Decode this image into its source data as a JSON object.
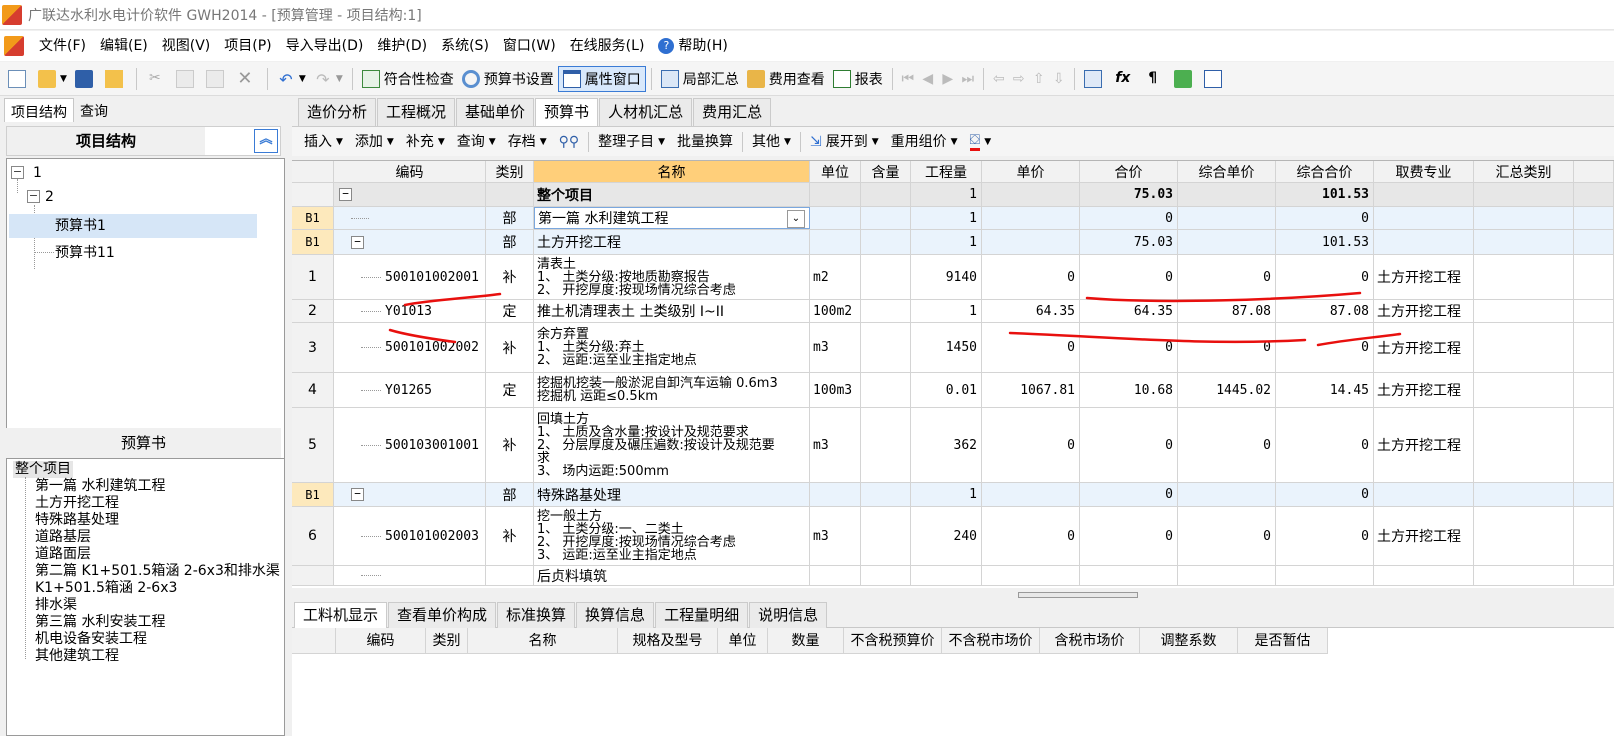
{
  "window": {
    "title": "广联达水利水电计价软件 GWH2014 - [预算管理 - 项目结构:1]"
  },
  "menu": [
    "文件(F)",
    "编辑(E)",
    "视图(V)",
    "项目(P)",
    "导入导出(D)",
    "维护(D)",
    "系统(S)",
    "窗口(W)",
    "在线服务(L)",
    "帮助(H)"
  ],
  "toolbar": {
    "compliance": "符合性检查",
    "budget_settings": "预算书设置",
    "property_window": "属性窗口",
    "partial_summary": "局部汇总",
    "fee_view": "费用查看",
    "report": "报表"
  },
  "left": {
    "tabs": [
      "项目结构",
      "查询"
    ],
    "structure_title": "项目结构",
    "tree": [
      {
        "label": "1",
        "toggle": "−"
      },
      {
        "label": "2",
        "toggle": "−"
      },
      {
        "label": "预算书1"
      },
      {
        "label": "预算书11"
      }
    ],
    "book_title": "预算书",
    "book_items": [
      "整个项目",
      "第一篇 水利建筑工程",
      "土方开挖工程",
      "特殊路基处理",
      "道路基层",
      "道路面层",
      "第二篇 K1+501.5箱涵 2-6x3和排水渠",
      "K1+501.5箱涵 2-6x3",
      "排水渠",
      "第三篇 水利安装工程",
      "机电设备安装工程",
      "其他建筑工程"
    ]
  },
  "tabs": [
    "造价分析",
    "工程概况",
    "基础单价",
    "预算书",
    "人材机汇总",
    "费用汇总"
  ],
  "subtoolbar": [
    {
      "label": "插入",
      "dd": true
    },
    {
      "label": "添加",
      "dd": true
    },
    {
      "label": "补充",
      "dd": true
    },
    {
      "label": "查询",
      "dd": true
    },
    {
      "label": "存档",
      "dd": true
    },
    {
      "label": "整理子目",
      "dd": true
    },
    {
      "label": "批量换算",
      "dd": false
    },
    {
      "label": "其他",
      "dd": true
    },
    {
      "label": "展开到",
      "dd": true
    },
    {
      "label": "重用组价",
      "dd": true
    }
  ],
  "grid": {
    "headers": [
      "编码",
      "类别",
      "名称",
      "单位",
      "含量",
      "工程量",
      "单价",
      "合价",
      "综合单价",
      "综合合价",
      "取费专业",
      "汇总类别"
    ],
    "rows": [
      {
        "num": "",
        "code": "",
        "type": "",
        "name": [
          "整个项目"
        ],
        "unit": "",
        "qty": "1",
        "price": "",
        "total": "75.03",
        "cunit": "",
        "ctotal": "101.53",
        "major": "",
        "kind": "total"
      },
      {
        "num": "B1",
        "code": "",
        "type": "部",
        "name": [
          "第一篇 水利建筑工程"
        ],
        "unit": "",
        "qty": "1",
        "price": "",
        "total": "0",
        "cunit": "",
        "ctotal": "0",
        "major": "",
        "kind": "blue"
      },
      {
        "num": "B1",
        "code": "",
        "type": "部",
        "name": [
          "土方开挖工程"
        ],
        "unit": "",
        "qty": "1",
        "price": "",
        "total": "75.03",
        "cunit": "",
        "ctotal": "101.53",
        "major": "",
        "kind": "blue"
      },
      {
        "num": "1",
        "code": "500101002001",
        "type": "补",
        "name": [
          "清表土",
          "1、 土类分级:按地质勘察报告",
          "2、 开挖厚度:按现场情况综合考虑"
        ],
        "unit": "m2",
        "qty": "9140",
        "price": "0",
        "total": "0",
        "cunit": "0",
        "ctotal": "0",
        "major": "土方开挖工程",
        "kind": "white"
      },
      {
        "num": "2",
        "code": "Y01013",
        "type": "定",
        "name": [
          "推土机清理表土 土类级别 I~II"
        ],
        "unit": "100m2",
        "qty": "1",
        "price": "64.35",
        "total": "64.35",
        "cunit": "87.08",
        "ctotal": "87.08",
        "major": "土方开挖工程",
        "kind": "white"
      },
      {
        "num": "3",
        "code": "500101002002",
        "type": "补",
        "name": [
          "余方弃置",
          "1、 土类分级:弃土",
          "2、 运距:运至业主指定地点"
        ],
        "unit": "m3",
        "qty": "1450",
        "price": "0",
        "total": "0",
        "cunit": "0",
        "ctotal": "0",
        "major": "土方开挖工程",
        "kind": "white"
      },
      {
        "num": "4",
        "code": "Y01265",
        "type": "定",
        "name": [
          "挖掘机挖装一般淤泥自卸汽车运输 0.6m3",
          "挖掘机 运距≤0.5km"
        ],
        "unit": "100m3",
        "qty": "0.01",
        "price": "1067.81",
        "total": "10.68",
        "cunit": "1445.02",
        "ctotal": "14.45",
        "major": "土方开挖工程",
        "kind": "white"
      },
      {
        "num": "5",
        "code": "500103001001",
        "type": "补",
        "name": [
          "回填土方",
          "1、 土质及含水量:按设计及规范要求",
          "2、 分层厚度及碾压遍数:按设计及规范要",
          "求",
          "3、 场内运距:500mm"
        ],
        "unit": "m3",
        "qty": "362",
        "price": "0",
        "total": "0",
        "cunit": "0",
        "ctotal": "0",
        "major": "土方开挖工程",
        "kind": "white"
      },
      {
        "num": "B1",
        "code": "",
        "type": "部",
        "name": [
          "特殊路基处理"
        ],
        "unit": "",
        "qty": "1",
        "price": "",
        "total": "0",
        "cunit": "",
        "ctotal": "0",
        "major": "",
        "kind": "blue"
      },
      {
        "num": "6",
        "code": "500101002003",
        "type": "补",
        "name": [
          "挖一般土方",
          "1、 土类分级:一、二类土",
          "2、 开挖厚度:按现场情况综合考虑",
          "3、 运距:运至业主指定地点"
        ],
        "unit": "m3",
        "qty": "240",
        "price": "0",
        "total": "0",
        "cunit": "0",
        "ctotal": "0",
        "major": "土方开挖工程",
        "kind": "white"
      },
      {
        "num": "",
        "code": "",
        "type": "",
        "name": [
          "后贞料填筑"
        ],
        "unit": "",
        "qty": "",
        "price": "",
        "total": "",
        "cunit": "",
        "ctotal": "",
        "major": "",
        "kind": "white"
      }
    ]
  },
  "bottom": {
    "tabs": [
      "工料机显示",
      "查看单价构成",
      "标准换算",
      "换算信息",
      "工程量明细",
      "说明信息"
    ],
    "headers": [
      "编码",
      "类别",
      "名称",
      "规格及型号",
      "单位",
      "数量",
      "不含税预算价",
      "不含税市场价",
      "含税市场价",
      "调整系数",
      "是否暂估"
    ]
  },
  "colors": {
    "accent": "#3a7bd5",
    "selected_name": "#ffcf7a",
    "row_blue": "#eaf3fc",
    "annotation": "#e8100e"
  }
}
